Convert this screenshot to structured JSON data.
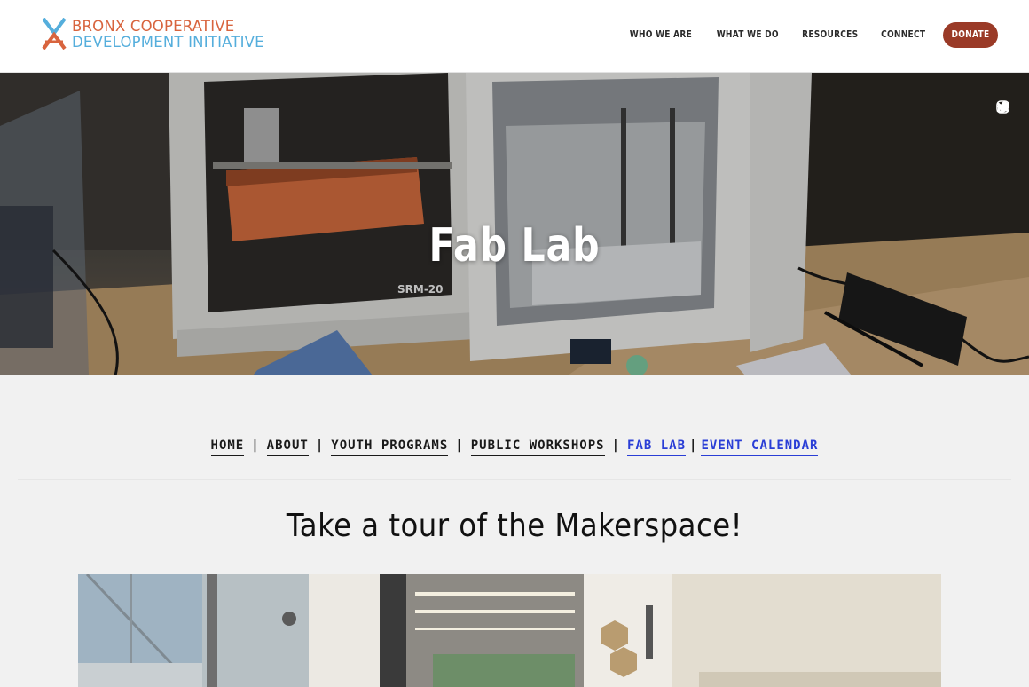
{
  "header": {
    "logo_line1": "BRONX COOPERATIVE",
    "logo_line2": "DEVELOPMENT INITIATIVE",
    "nav": [
      "WHO WE ARE",
      "WHAT WE DO",
      "RESOURCES",
      "CONNECT"
    ],
    "donate_label": "DONATE"
  },
  "hero": {
    "title": "Fab Lab",
    "machine_label": "SRM-20",
    "social_icons": [
      "instagram-icon",
      "twitter-icon",
      "facebook-icon",
      "medium-icon"
    ]
  },
  "subnav": {
    "items": [
      "HOME",
      "ABOUT",
      "YOUTH PROGRAMS",
      "PUBLIC WORKSHOPS",
      "FAB LAB",
      "EVENT CALENDAR"
    ],
    "separator": "|"
  },
  "main": {
    "section_title": "Take a tour of the Makerspace!"
  },
  "colors": {
    "logo_orange": "#d8643e",
    "logo_blue": "#55aedc",
    "donate_bg": "#9a3a27",
    "active_link": "#2a3ed6"
  }
}
